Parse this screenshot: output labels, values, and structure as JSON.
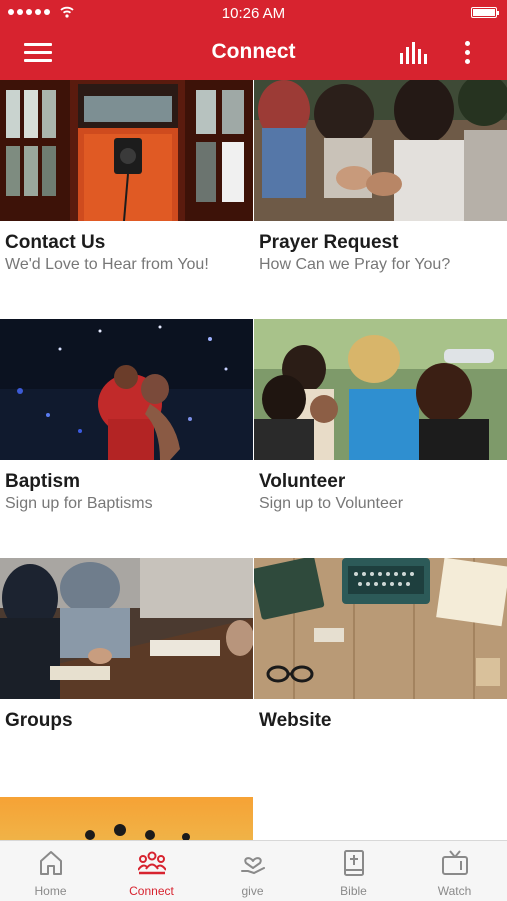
{
  "status_bar": {
    "time": "10:26 AM"
  },
  "header": {
    "title": "Connect"
  },
  "tiles": [
    {
      "title": "Contact Us",
      "subtitle": "We'd Love to Hear from You!"
    },
    {
      "title": "Prayer Request",
      "subtitle": "How Can we Pray for You?"
    },
    {
      "title": "Baptism",
      "subtitle": "Sign up for Baptisms"
    },
    {
      "title": "Volunteer",
      "subtitle": "Sign up to Volunteer"
    },
    {
      "title": "Groups",
      "subtitle": ""
    },
    {
      "title": "Website",
      "subtitle": ""
    }
  ],
  "tabs": [
    {
      "label": "Home",
      "icon": "home-icon"
    },
    {
      "label": "Connect",
      "icon": "people-icon",
      "active": true
    },
    {
      "label": "give",
      "icon": "give-heart-icon"
    },
    {
      "label": "Bible",
      "icon": "bible-icon"
    },
    {
      "label": "Watch",
      "icon": "tv-icon"
    }
  ],
  "colors": {
    "accent": "#d7232f",
    "tab_inactive": "#8a8a8a"
  }
}
